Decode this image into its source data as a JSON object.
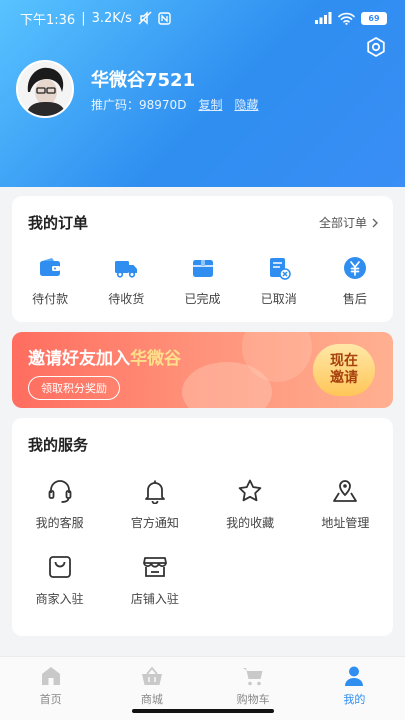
{
  "status_bar": {
    "time": "下午1:36",
    "speed": "3.2K/s",
    "battery": "69"
  },
  "profile": {
    "name": "华微谷7521",
    "promo_label": "推广码：",
    "promo_code": "98970D",
    "copy_label": "复制",
    "hide_label": "隐藏"
  },
  "orders": {
    "title": "我的订单",
    "all_label": "全部订单",
    "items": [
      {
        "label": "待付款",
        "icon": "wallet-icon"
      },
      {
        "label": "待收货",
        "icon": "truck-icon"
      },
      {
        "label": "已完成",
        "icon": "box-icon"
      },
      {
        "label": "已取消",
        "icon": "cancel-doc-icon"
      },
      {
        "label": "售后",
        "icon": "yen-icon"
      }
    ]
  },
  "banner": {
    "title_prefix": "邀请好友加入",
    "title_brand": "华微谷",
    "pill": "领取积分奖励",
    "button_line1": "现在",
    "button_line2": "邀请"
  },
  "services": {
    "title": "我的服务",
    "items": [
      {
        "label": "我的客服",
        "icon": "headset-icon"
      },
      {
        "label": "官方通知",
        "icon": "bell-icon"
      },
      {
        "label": "我的收藏",
        "icon": "star-icon"
      },
      {
        "label": "地址管理",
        "icon": "map-pin-icon"
      },
      {
        "label": "商家入驻",
        "icon": "bag-icon"
      },
      {
        "label": "店铺入驻",
        "icon": "store-icon"
      }
    ]
  },
  "tabbar": {
    "items": [
      {
        "label": "首页",
        "icon": "home-icon"
      },
      {
        "label": "商城",
        "icon": "basket-icon"
      },
      {
        "label": "购物车",
        "icon": "cart-icon"
      },
      {
        "label": "我的",
        "icon": "user-icon"
      }
    ],
    "active_index": 3
  },
  "colors": {
    "primary": "#2f8ef0",
    "banner": "#ff6d5f",
    "accent_yellow": "#ffe08a"
  }
}
